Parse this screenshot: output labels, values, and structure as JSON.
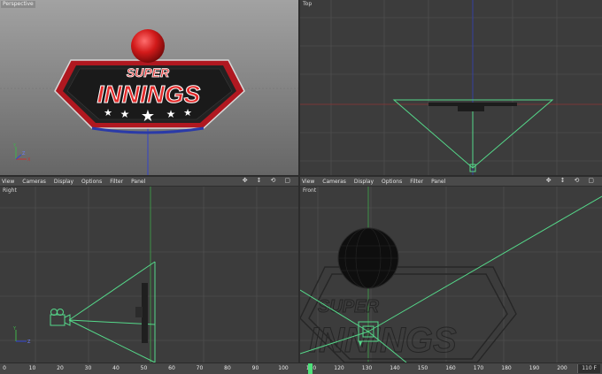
{
  "viewports": {
    "perspective": {
      "title": "Perspective"
    },
    "top": {
      "title": "Top"
    },
    "right": {
      "title": "Right"
    },
    "front": {
      "title": "Front"
    }
  },
  "menu": [
    "View",
    "Cameras",
    "Display",
    "Options",
    "Filter",
    "Panel"
  ],
  "nav_icons": [
    "move-icon",
    "zoom-icon",
    "rotate-icon",
    "maximize-icon"
  ],
  "logo": {
    "line1": "SUPER",
    "line2": "INNINGS",
    "stars": 5
  },
  "axis_labels": {
    "x": "X",
    "y": "Y",
    "z": "Z"
  },
  "timeline": {
    "ticks": [
      "0",
      "10",
      "20",
      "30",
      "40",
      "50",
      "60",
      "70",
      "80",
      "90",
      "100",
      "110",
      "120",
      "130",
      "140",
      "150",
      "160",
      "170",
      "180",
      "190",
      "200"
    ],
    "current_frame_label": "110 F"
  },
  "colors": {
    "camera_green": "#55d98a",
    "grid_line": "#5a5a5a",
    "viewport_bg": "#3b3b3b",
    "perspective_bg_top": "#9a9a9a",
    "perspective_bg_bottom": "#6b6b6b",
    "logo_red": "#c8141c",
    "axis_blue": "#2f44d6",
    "axis_red": "#c63030",
    "axis_green": "#3fb34a"
  }
}
